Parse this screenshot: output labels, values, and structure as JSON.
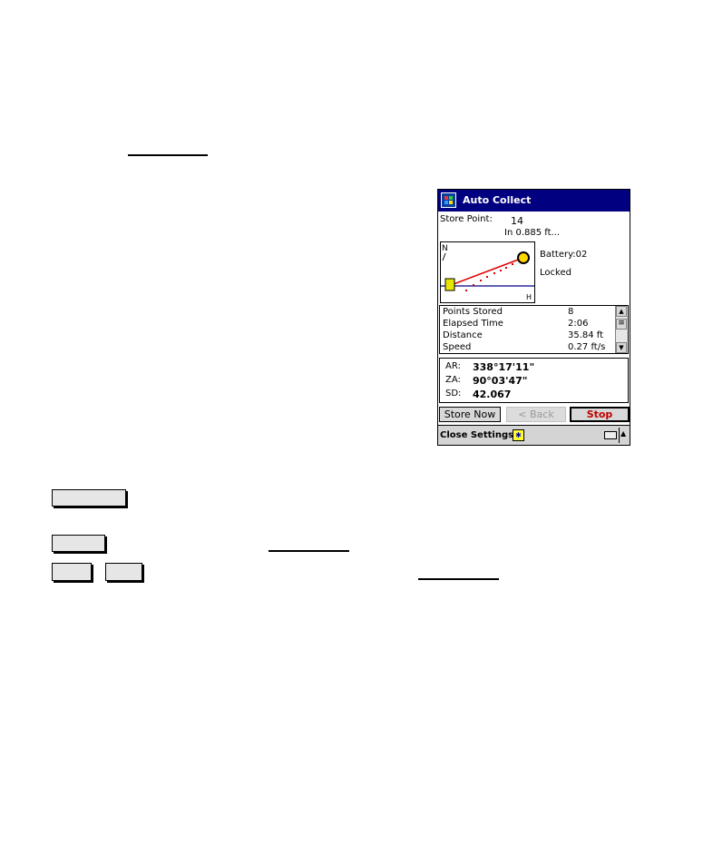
{
  "device": {
    "title": "Auto Collect",
    "store_point": {
      "label": "Store Point:",
      "value": "14",
      "distance": "In 0.885 ft..."
    },
    "plot": {
      "north_label": "N",
      "h_label": "H"
    },
    "status": {
      "battery": "Battery:02",
      "lock": "Locked"
    },
    "stats": [
      {
        "key": "Points Stored",
        "value": "8"
      },
      {
        "key": "Elapsed Time",
        "value": "2:06"
      },
      {
        "key": "Distance",
        "value": "35.84 ft"
      },
      {
        "key": "Speed",
        "value": "0.27 ft/s"
      }
    ],
    "coords": [
      {
        "key": "AR:",
        "value": "338°17'11\""
      },
      {
        "key": "ZA:",
        "value": "90°03'47\""
      },
      {
        "key": "SD:",
        "value": "42.067"
      }
    ],
    "buttons": {
      "store_now": "Store Now",
      "back": "< Back",
      "stop": "Stop"
    },
    "cmdbar": {
      "close_settings": "Close Settings"
    },
    "colors": {
      "titlebar": "#000080",
      "stop": "#c00000",
      "trace": "#e00000",
      "horizon": "#000080"
    }
  }
}
